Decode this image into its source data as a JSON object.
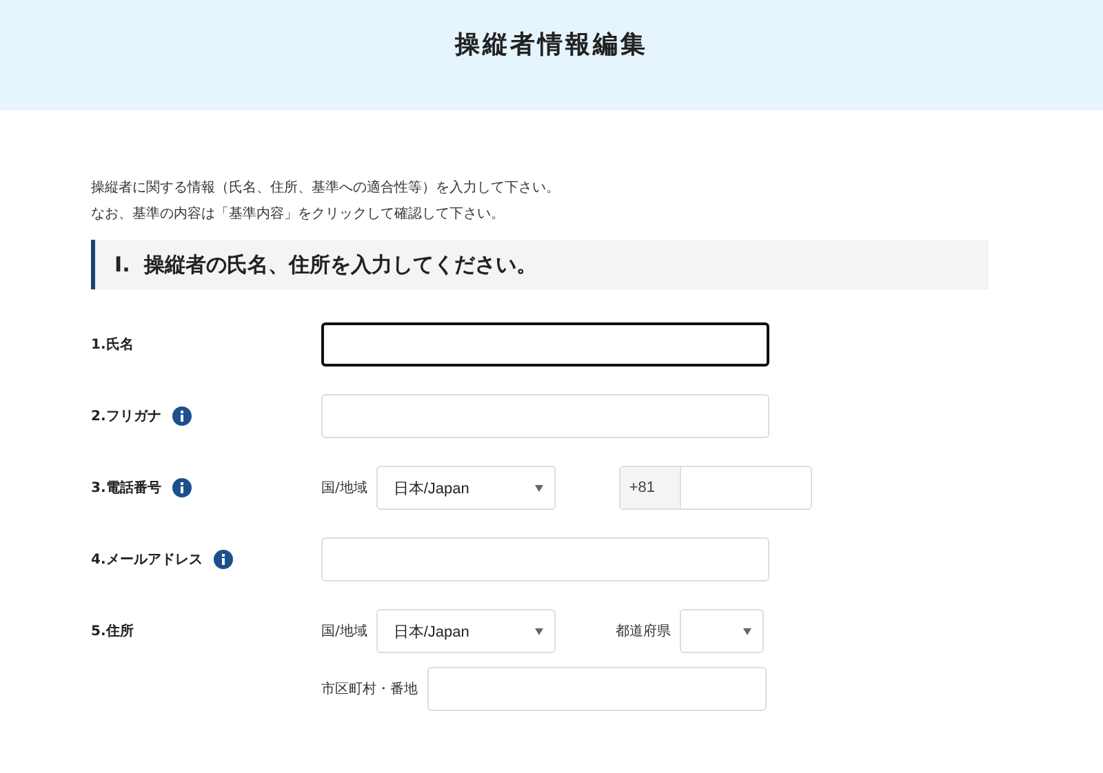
{
  "header": {
    "title": "操縦者情報編集"
  },
  "intro": [
    "操縦者に関する情報（氏名、住所、基準への適合性等）を入力して下さい。",
    "なお、基準の内容は「基準内容」をクリックして確認して下さい。"
  ],
  "section": {
    "number": "I.",
    "title": "操縦者の氏名、住所を入力してください。"
  },
  "fields": [
    {
      "kind": "text",
      "label": "1.氏名",
      "info": false,
      "focused": true
    },
    {
      "kind": "text",
      "label": "2.フリガナ",
      "info": true,
      "focused": false
    },
    {
      "kind": "phone",
      "label": "3.電話番号",
      "info": true,
      "country_label": "国/地域",
      "country": "日本/Japan",
      "prefix": "+81"
    },
    {
      "kind": "text",
      "label": "4.メールアドレス",
      "info": true,
      "focused": false
    },
    {
      "kind": "address",
      "label": "5.住所",
      "info": false,
      "country_label": "国/地域",
      "country": "日本/Japan",
      "prefecture_label": "都道府県",
      "city_label": "市区町村・番地"
    }
  ]
}
